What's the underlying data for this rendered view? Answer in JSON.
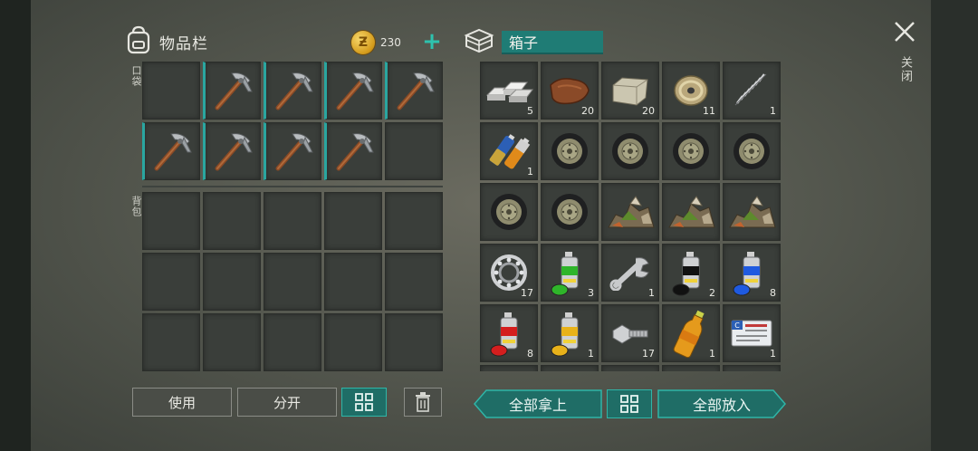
{
  "inventory": {
    "title": "物品栏",
    "coins": "230",
    "pocket_label": "口袋",
    "backpack_label": "背包"
  },
  "chest": {
    "title": "箱子"
  },
  "close": {
    "label": "关闭"
  },
  "buttons": {
    "use": "使用",
    "split": "分开",
    "take_all": "全部拿上",
    "put_all": "全部放入"
  },
  "pocket_slots": [
    {
      "item": "empty",
      "qty": ""
    },
    {
      "item": "pickaxe-icon",
      "qty": ""
    },
    {
      "item": "pickaxe-icon",
      "qty": ""
    },
    {
      "item": "pickaxe-icon",
      "qty": ""
    },
    {
      "item": "pickaxe-icon",
      "qty": ""
    },
    {
      "item": "pickaxe-icon",
      "qty": ""
    },
    {
      "item": "pickaxe-icon",
      "qty": ""
    },
    {
      "item": "pickaxe-icon",
      "qty": ""
    },
    {
      "item": "pickaxe-icon",
      "qty": ""
    },
    {
      "item": "empty",
      "qty": ""
    }
  ],
  "chest_slots": [
    {
      "item": "metal-ingot-icon",
      "qty": "5"
    },
    {
      "item": "leather-icon",
      "qty": "20"
    },
    {
      "item": "stone-block-icon",
      "qty": "20"
    },
    {
      "item": "wire-spool-icon",
      "qty": "11"
    },
    {
      "item": "spring-icon",
      "qty": "1"
    },
    {
      "item": "batteries-icon",
      "qty": "1"
    },
    {
      "item": "tire-icon",
      "qty": ""
    },
    {
      "item": "tire-icon",
      "qty": ""
    },
    {
      "item": "tire-icon",
      "qty": ""
    },
    {
      "item": "tire-icon",
      "qty": ""
    },
    {
      "item": "tire-icon",
      "qty": ""
    },
    {
      "item": "tire-icon",
      "qty": ""
    },
    {
      "item": "rubble-icon",
      "qty": ""
    },
    {
      "item": "rubble-icon",
      "qty": ""
    },
    {
      "item": "rubble-icon",
      "qty": ""
    },
    {
      "item": "bearing-icon",
      "qty": "17"
    },
    {
      "item": "spray-paint-green-icon",
      "qty": "3"
    },
    {
      "item": "wrench-icon",
      "qty": "1"
    },
    {
      "item": "spray-paint-black-icon",
      "qty": "2"
    },
    {
      "item": "spray-paint-blue-icon",
      "qty": "8"
    },
    {
      "item": "spray-paint-red-icon",
      "qty": "8"
    },
    {
      "item": "spray-paint-yellow-icon",
      "qty": "1"
    },
    {
      "item": "bolt-nut-icon",
      "qty": "17"
    },
    {
      "item": "bottle-icon",
      "qty": "1"
    },
    {
      "item": "id-card-icon",
      "qty": "1"
    }
  ],
  "colors": {
    "accent": "#2aa6a0",
    "teal_button": "#1f6d66",
    "chest_name_bg": "#1f7c75"
  }
}
